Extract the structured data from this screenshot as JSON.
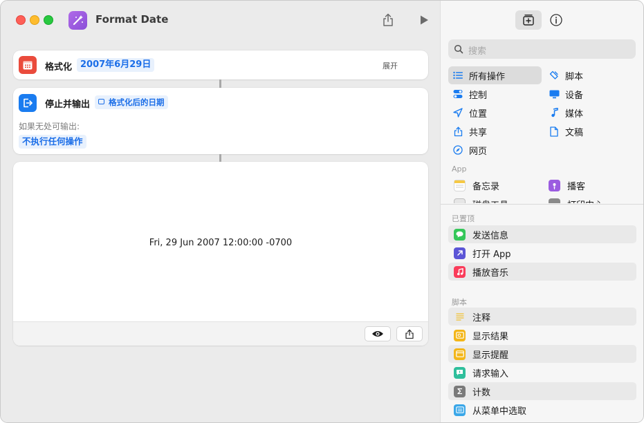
{
  "window": {
    "title": "Format Date"
  },
  "editor": {
    "format_action": {
      "label": "格式化",
      "date_value": "2007年6月29日",
      "expand_label": "展开"
    },
    "stop_action": {
      "label": "停止并输出",
      "token_label": "格式化后的日期",
      "fallback_label": "如果无处可输出:",
      "fallback_value": "不执行任何操作"
    },
    "output": {
      "text": "Fri, 29 Jun 2007 12:00:00 -0700"
    }
  },
  "sidebar": {
    "search_placeholder": "搜索",
    "categories_left": [
      "所有操作",
      "控制",
      "位置",
      "共享",
      "网页"
    ],
    "categories_right": [
      "脚本",
      "设备",
      "媒体",
      "文稿"
    ],
    "app_section": {
      "title": "App",
      "items": [
        "备忘录",
        "播客",
        "磁盘工具",
        "打印中心"
      ]
    },
    "pinned_section": {
      "title": "已置顶",
      "items": [
        "发送信息",
        "打开 App",
        "播放音乐"
      ]
    },
    "script_section": {
      "title": "脚本",
      "items": [
        "注释",
        "显示结果",
        "显示提醒",
        "请求输入",
        "计数",
        "从菜单中选取"
      ]
    }
  },
  "colors": {
    "accent": "#1b6ee8",
    "format_icon": "#ea4b3c",
    "stop_icon": "#1a7cf0",
    "app_icon": "#9b5ce0"
  }
}
